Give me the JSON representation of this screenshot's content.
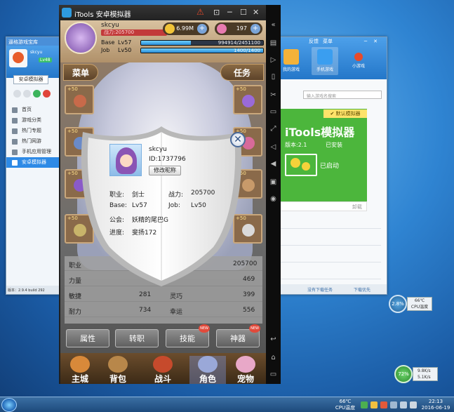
{
  "left_window": {
    "title": "逼格游戏宝库",
    "user": "skcyu",
    "level": "Lv48",
    "tab": "安卓模拟器",
    "menu": [
      {
        "label": "首页",
        "icon": "home-icon"
      },
      {
        "label": "游戏分类",
        "icon": "grid-icon"
      },
      {
        "label": "热门专题",
        "icon": "fire-icon"
      },
      {
        "label": "热门网游",
        "icon": "globe-icon"
      },
      {
        "label": "手机应用管理",
        "icon": "phone-icon"
      },
      {
        "label": "安卓模拟器",
        "icon": "android-icon"
      }
    ],
    "footer": "版本：2.9.4 build 292"
  },
  "right_window": {
    "feedback": "反馈",
    "menu": "菜单",
    "tabs": [
      {
        "label": "我的游戏",
        "icon": "gamepad-icon",
        "color": "#f3b23a"
      },
      {
        "label": "手机游戏",
        "icon": "phone-icon",
        "color": "#3a9ef0"
      },
      {
        "label": "小游戏",
        "icon": "joystick-icon",
        "color": "#e84a2b"
      }
    ],
    "search_placeholder": "输入游戏名搜索",
    "card": {
      "badge": "✔ 默认模拟器",
      "title": "iTools模拟器",
      "version": "版本:2.1",
      "installed": "已安装",
      "running": "已启动",
      "delete": "卸载"
    },
    "footer_left": "没有下载任务",
    "footer_right": "下载优先"
  },
  "emulator": {
    "title": "iTools 安卓模拟器",
    "warn": "⚠",
    "controls": [
      "⊡",
      "─",
      "☐",
      "✕"
    ]
  },
  "game": {
    "player_name": "skcyu",
    "combat_label": "战力:205700",
    "gold": "6.99M",
    "gems": "197",
    "base_label": "Base",
    "base_level": "Lv57",
    "base_exp": "994914/2451100",
    "base_progress": 0.41,
    "job_label": "Job",
    "job_level": "Lv50",
    "job_exp": "1400/1400",
    "job_progress": 1.0,
    "menu_btn": "菜单",
    "task_btn": "任务",
    "slots_left": [
      "+50",
      "+50",
      "+50",
      "+50",
      "+50"
    ],
    "slots_right": [
      "+50",
      "+50",
      "+50",
      "+50",
      "+50"
    ],
    "stats": [
      {
        "l": "职业",
        "lv": "",
        "r": "",
        "rv": "205700"
      },
      {
        "l": "力量",
        "lv": "",
        "r": "",
        "rv": "469"
      },
      {
        "l": "敏捷",
        "lv": "281",
        "r": "灵巧",
        "rv": "399"
      },
      {
        "l": "耐力",
        "lv": "734",
        "r": "幸运",
        "rv": "556"
      }
    ],
    "bottom_buttons": [
      "属性",
      "转职",
      "技能",
      "神器"
    ],
    "new_badge": "NEW",
    "nav": [
      {
        "label": "主城",
        "color": "#d8893a"
      },
      {
        "label": "背包",
        "color": "#b8874a"
      },
      {
        "label": "战斗",
        "color": "#c64a2c"
      },
      {
        "label": "角色",
        "color": "#9aa8d8"
      },
      {
        "label": "宠物",
        "color": "#e8a8c8"
      }
    ]
  },
  "modal": {
    "name": "skcyu",
    "id": "ID:1737796",
    "rename": "修改昵称",
    "job_label": "职业:",
    "job": "剑士",
    "power_label": "战力:",
    "power": "205700",
    "base_label": "Base:",
    "base": "Lv57",
    "joblv_label": "Job:",
    "joblv": "Lv50",
    "guild_label": "公会:",
    "guild": "妖精的尾巴G",
    "progress_label": "进度:",
    "progress": "斐扬172"
  },
  "desktop": {
    "cpu_widget": {
      "pct": "2.8%",
      "temp": "66℃",
      "temp_label": "CPU温度"
    },
    "net_widget": {
      "pct": "72%",
      "up": "9.8K/s",
      "down": "5.1K/s"
    },
    "taskbar_temp": "66℃",
    "taskbar_temp_label": "CPU温度",
    "time": "22:13",
    "date": "2016-06-19"
  }
}
